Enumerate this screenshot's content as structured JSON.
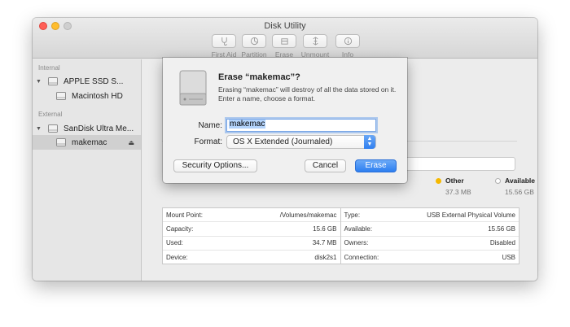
{
  "window": {
    "title": "Disk Utility"
  },
  "toolbar": {
    "items": [
      {
        "label": "First Aid",
        "icon": "stethoscope-icon"
      },
      {
        "label": "Partition",
        "icon": "partition-pie-icon"
      },
      {
        "label": "Erase",
        "icon": "erase-icon"
      },
      {
        "label": "Unmount",
        "icon": "unmount-icon"
      },
      {
        "label": "Info",
        "icon": "info-icon"
      }
    ]
  },
  "sidebar": {
    "internal_header": "Internal",
    "external_header": "External",
    "internal_disk": "APPLE SSD S...",
    "internal_volume": "Macintosh HD",
    "external_disk": "SanDisk Ultra Me...",
    "external_volume": "makemac"
  },
  "usage": {
    "other": {
      "label": "Other",
      "value": "37.3 MB",
      "color": "#f5b800"
    },
    "available": {
      "label": "Available",
      "value": "15.56 GB",
      "color": "#ffffff"
    }
  },
  "info": {
    "left": [
      {
        "key": "Mount Point:",
        "value": "/Volumes/makemac"
      },
      {
        "key": "Capacity:",
        "value": "15.6 GB"
      },
      {
        "key": "Used:",
        "value": "34.7 MB"
      },
      {
        "key": "Device:",
        "value": "disk2s1"
      }
    ],
    "right": [
      {
        "key": "Type:",
        "value": "USB External Physical Volume"
      },
      {
        "key": "Available:",
        "value": "15.56 GB"
      },
      {
        "key": "Owners:",
        "value": "Disabled"
      },
      {
        "key": "Connection:",
        "value": "USB"
      }
    ]
  },
  "dialog": {
    "title": "Erase “makemac”?",
    "message": "Erasing “makemac” will destroy of all the data stored on it. Enter a name, choose a format.",
    "name_label": "Name:",
    "name_value": "makemac",
    "format_label": "Format:",
    "format_value": "OS X Extended (Journaled)",
    "security_button": "Security Options...",
    "cancel_button": "Cancel",
    "erase_button": "Erase",
    "accent_color": "#2d7ef0"
  }
}
